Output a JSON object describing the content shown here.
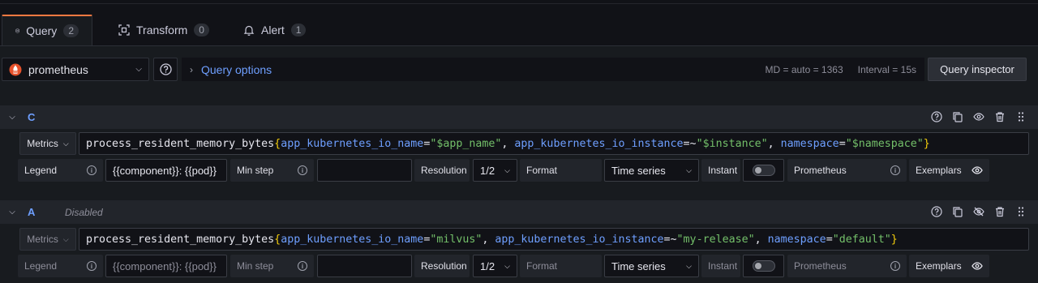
{
  "tabs": [
    {
      "label": "Query",
      "count": "2"
    },
    {
      "label": "Transform",
      "count": "0"
    },
    {
      "label": "Alert",
      "count": "1"
    }
  ],
  "datasource": {
    "name": "prometheus"
  },
  "query_options": {
    "label": "Query options",
    "md": "MD = auto = 1363",
    "interval": "Interval = 15s"
  },
  "inspector_label": "Query inspector",
  "queries": [
    {
      "refid": "C",
      "disabled_label": "",
      "metrics_label": "Metrics",
      "expr": {
        "metric": "process_resident_memory_bytes",
        "l1": "app_kubernetes_io_name",
        "op1": "=",
        "v1": "\"$app_name\"",
        "l2": "app_kubernetes_io_instance",
        "op2": "=~",
        "v2": "\"$instance\"",
        "l3": "namespace",
        "op3": "=",
        "v3": "\"$namespace\""
      },
      "legend_label": "Legend",
      "legend_value": "{{component}}: {{pod}}",
      "minstep_label": "Min step",
      "minstep_value": "",
      "resolution_label": "Resolution",
      "resolution_value": "1/2",
      "format_label": "Format",
      "format_value": "Time series",
      "instant_label": "Instant",
      "prometheus_label": "Prometheus",
      "exemplars_label": "Exemplars"
    },
    {
      "refid": "A",
      "disabled_label": "Disabled",
      "metrics_label": "Metrics",
      "expr": {
        "metric": "process_resident_memory_bytes",
        "l1": "app_kubernetes_io_name",
        "op1": "=",
        "v1": "\"milvus\"",
        "l2": "app_kubernetes_io_instance",
        "op2": "=~",
        "v2": "\"my-release\"",
        "l3": "namespace",
        "op3": "=",
        "v3": "\"default\""
      },
      "legend_label": "Legend",
      "legend_value": "{{component}}: {{pod}}",
      "minstep_label": "Min step",
      "minstep_value": "",
      "resolution_label": "Resolution",
      "resolution_value": "1/2",
      "format_label": "Format",
      "format_value": "Time series",
      "instant_label": "Instant",
      "prometheus_label": "Prometheus",
      "exemplars_label": "Exemplars"
    }
  ],
  "colors": {
    "accent": "#ff7941",
    "link": "#6e9fff",
    "string": "#73bf69",
    "brace": "#f2cc0c"
  }
}
